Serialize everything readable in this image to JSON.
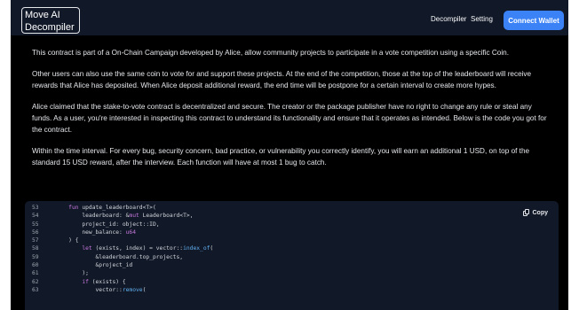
{
  "nav": {
    "logo_line1": "Move AI",
    "logo_line2": "Decompiler",
    "decompiler": "Decompiler",
    "setting": "Setting",
    "connect_wallet": "Connect Wallet"
  },
  "paragraphs": [
    "This contract is part of a On-Chain Campaign developed by Alice, allow community projects to participate in a vote competition using a specific Coin.",
    "Other users can also use the same coin to vote for and support these projects. At the end of the competition, those at the top of the leaderboard will receive rewards that Alice has deposited. When Alice deposit additional reward, the end time will be postpone for a certain interval to create more hypes.",
    "Alice claimed that the stake-to-vote contract is decentralized and secure. The creator or the package publisher have no right to change any rule or steal any funds. As a user, you're interested in inspecting this contract to understand its functionality and ensure that it operates as intended. Below is the code you got for the contract.",
    "Within the time interval. For every bug, security concern, bad practice, or vulnerability you correctly identify, you will earn an additional 1 USD, on top of the standard 15 USD reward, after the interview. Each function will have at most 1 bug to catch."
  ],
  "code": {
    "copy_label": "Copy",
    "lines": [
      {
        "n": "53",
        "text": "    fun update_leaderboard<T>("
      },
      {
        "n": "54",
        "text": "        leaderboard: &mut Leaderboard<T>,"
      },
      {
        "n": "55",
        "text": "        project_id: object::ID,"
      },
      {
        "n": "56",
        "text": "        new_balance: u64"
      },
      {
        "n": "57",
        "text": "    ) {"
      },
      {
        "n": "58",
        "text": "        let (exists, index) = vector::index_of("
      },
      {
        "n": "59",
        "text": "            &leaderboard.top_projects,"
      },
      {
        "n": "60",
        "text": "            &project_id"
      },
      {
        "n": "61",
        "text": "        );"
      },
      {
        "n": "62",
        "text": "        if (exists) {"
      },
      {
        "n": "63",
        "text": "            vector::remove("
      }
    ]
  },
  "colors": {
    "accent": "#3b82f6",
    "page_bg": "#000000",
    "navbar_bg": "#111827",
    "code_bg": "#111827"
  }
}
